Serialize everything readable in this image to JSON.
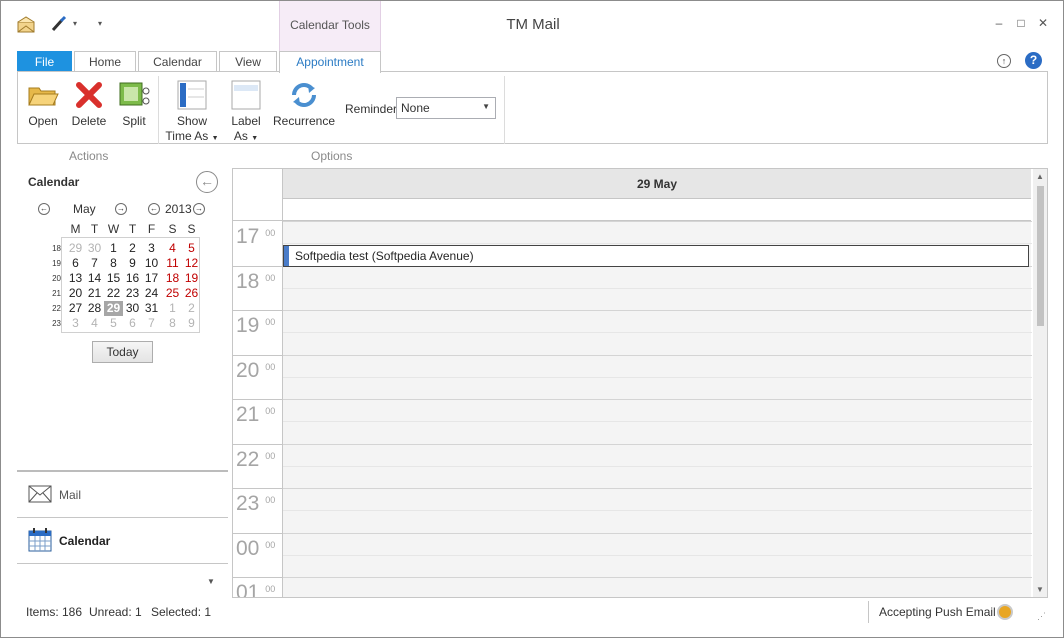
{
  "window": {
    "title": "TM Mail",
    "context_tab_group": "Calendar Tools"
  },
  "qat": {
    "icons": [
      "app-envelope-icon",
      "brush-icon",
      "dropdown-caret-icon",
      "customize-qat-icon"
    ]
  },
  "tabs": [
    "File",
    "Home",
    "Calendar",
    "View",
    "Appointment"
  ],
  "active_tab": "Appointment",
  "ribbon": {
    "actions": {
      "open": "Open",
      "delete": "Delete",
      "split": "Split",
      "group_label": "Actions"
    },
    "options": {
      "show_time_as_1": "Show",
      "show_time_as_2": "Time As",
      "label_as_1": "Label",
      "label_as_2": "As",
      "recurrence": "Recurrence",
      "reminder_label": "Reminder",
      "reminder_value": "None",
      "group_label": "Options"
    }
  },
  "navpane": {
    "title": "Calendar",
    "mini_calendar": {
      "month": "May",
      "year": "2013",
      "weekday_headers": [
        "M",
        "T",
        "W",
        "T",
        "F",
        "S",
        "S"
      ],
      "week_numbers": [
        "18",
        "19",
        "20",
        "21",
        "22",
        "23"
      ],
      "weeks": [
        [
          "29",
          "30",
          "1",
          "2",
          "3",
          "4",
          "5"
        ],
        [
          "6",
          "7",
          "8",
          "9",
          "10",
          "11",
          "12"
        ],
        [
          "13",
          "14",
          "15",
          "16",
          "17",
          "18",
          "19"
        ],
        [
          "20",
          "21",
          "22",
          "23",
          "24",
          "25",
          "26"
        ],
        [
          "27",
          "28",
          "29",
          "30",
          "31",
          "1",
          "2"
        ],
        [
          "3",
          "4",
          "5",
          "6",
          "7",
          "8",
          "9"
        ]
      ],
      "selected_day": "29"
    },
    "today_button": "Today",
    "modules": {
      "mail": "Mail",
      "calendar": "Calendar"
    }
  },
  "day_view": {
    "date_header": "29 May",
    "hours": [
      "17",
      "18",
      "19",
      "20",
      "21",
      "22",
      "23",
      "00",
      "01"
    ],
    "minutes_label": "00",
    "appointment": {
      "title": "Softpedia test (Softpedia Avenue)",
      "hour": "17",
      "accent": "#4a7cc9"
    }
  },
  "statusbar": {
    "items": "Items: 186",
    "unread": "Unread: 1",
    "selected": "Selected: 1",
    "push": "Accepting Push Email",
    "push_color": "#e8a623"
  }
}
